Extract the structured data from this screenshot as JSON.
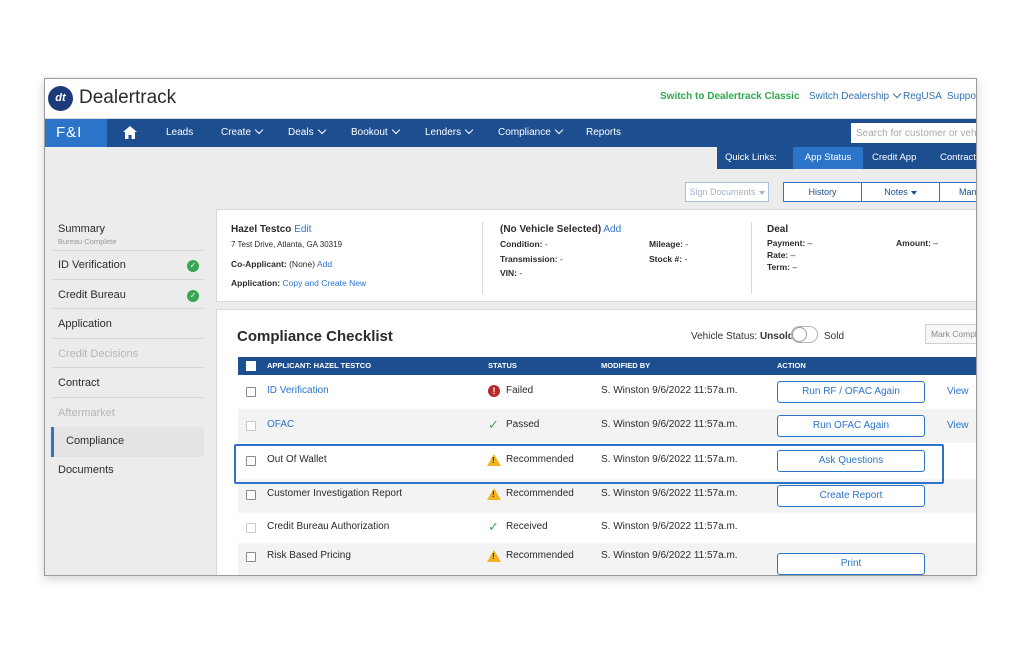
{
  "topbar": {
    "brand": "Dealertrack",
    "logo_text": "dt",
    "switch_classic": "Switch to Dealertrack Classic",
    "switch_dealership": "Switch Dealership",
    "regusa": "RegUSA",
    "support": "Suppo"
  },
  "nav": {
    "section": "F&I",
    "items": [
      "Leads",
      "Create",
      "Deals",
      "Bookout",
      "Lenders",
      "Compliance",
      "Reports"
    ],
    "search_placeholder": "Search for customer or vehicle"
  },
  "quick_links": {
    "label": "Quick Links:",
    "items": [
      "App Status",
      "Credit App",
      "Contract"
    ]
  },
  "toolbar": {
    "sign_documents": "Sign Documents",
    "history": "History",
    "notes": "Notes",
    "manage": "Mana"
  },
  "sidebar": {
    "summary": "Summary",
    "summary_sub": "Bureau Complete",
    "items": [
      "ID Verification",
      "Credit Bureau",
      "Application",
      "Credit Decisions",
      "Contract",
      "Aftermarket",
      "Compliance",
      "Documents"
    ],
    "check_glyph": "✓"
  },
  "deal_card": {
    "customer_name": "Hazel Testco",
    "edit": "Edit",
    "address": "7 Test Drive, Atlanta, GA 30319",
    "co_applicant_label": "Co-Applicant:",
    "co_applicant_value": "(None)",
    "add": "Add",
    "application_label": "Application:",
    "application_link": "Copy and Create New",
    "vehicle_title": "(No Vehicle Selected)",
    "vehicle_add": "Add",
    "condition_label": "Condition:",
    "condition_value": "-",
    "transmission_label": "Transmission:",
    "transmission_value": "-",
    "vin_label": "VIN:",
    "vin_value": "-",
    "mileage_label": "Mileage:",
    "mileage_value": "-",
    "stock_label": "Stock #:",
    "stock_value": "-",
    "deal_title": "Deal",
    "payment_label": "Payment:",
    "payment_value": "–",
    "rate_label": "Rate:",
    "rate_value": "–",
    "term_label": "Term:",
    "term_value": "–",
    "amount_label": "Amount:",
    "amount_value": "–"
  },
  "compliance": {
    "title": "Compliance Checklist",
    "vehicle_status_label": "Vehicle Status:",
    "vehicle_status_value": "Unsold",
    "sold_label": "Sold",
    "mark_complete": "Mark Complete",
    "headers": [
      "Applicant: Hazel Testco",
      "Status",
      "Modified By",
      "Action"
    ],
    "rows": [
      {
        "name": "ID Verification",
        "status": "Failed",
        "modified": "S. Winston 9/6/2022 11:57a.m.",
        "action": "Run RF / OFAC Again",
        "view": "View"
      },
      {
        "name": "OFAC",
        "status": "Passed",
        "modified": "S. Winston 9/6/2022 11:57a.m.",
        "action": "Run OFAC Again",
        "view": "View"
      },
      {
        "name": "Out Of Wallet",
        "status": "Recommended",
        "modified": "S. Winston 9/6/2022 11:57a.m.",
        "action": "Ask Questions",
        "view": ""
      },
      {
        "name": "Customer Investigation Report",
        "status": "Recommended",
        "modified": "S. Winston 9/6/2022 11:57a.m.",
        "action": "Create Report",
        "view": ""
      },
      {
        "name": "Credit Bureau Authorization",
        "status": "Received",
        "modified": "S. Winston 9/6/2022 11:57a.m.",
        "action": "",
        "view": ""
      },
      {
        "name": "Risk Based Pricing",
        "status": "Recommended",
        "modified": "S. Winston 9/6/2022 11:57a.m.",
        "action": "Print",
        "view": ""
      }
    ],
    "icons": {
      "failed": "!",
      "passed": "✓",
      "warning": "!"
    }
  }
}
